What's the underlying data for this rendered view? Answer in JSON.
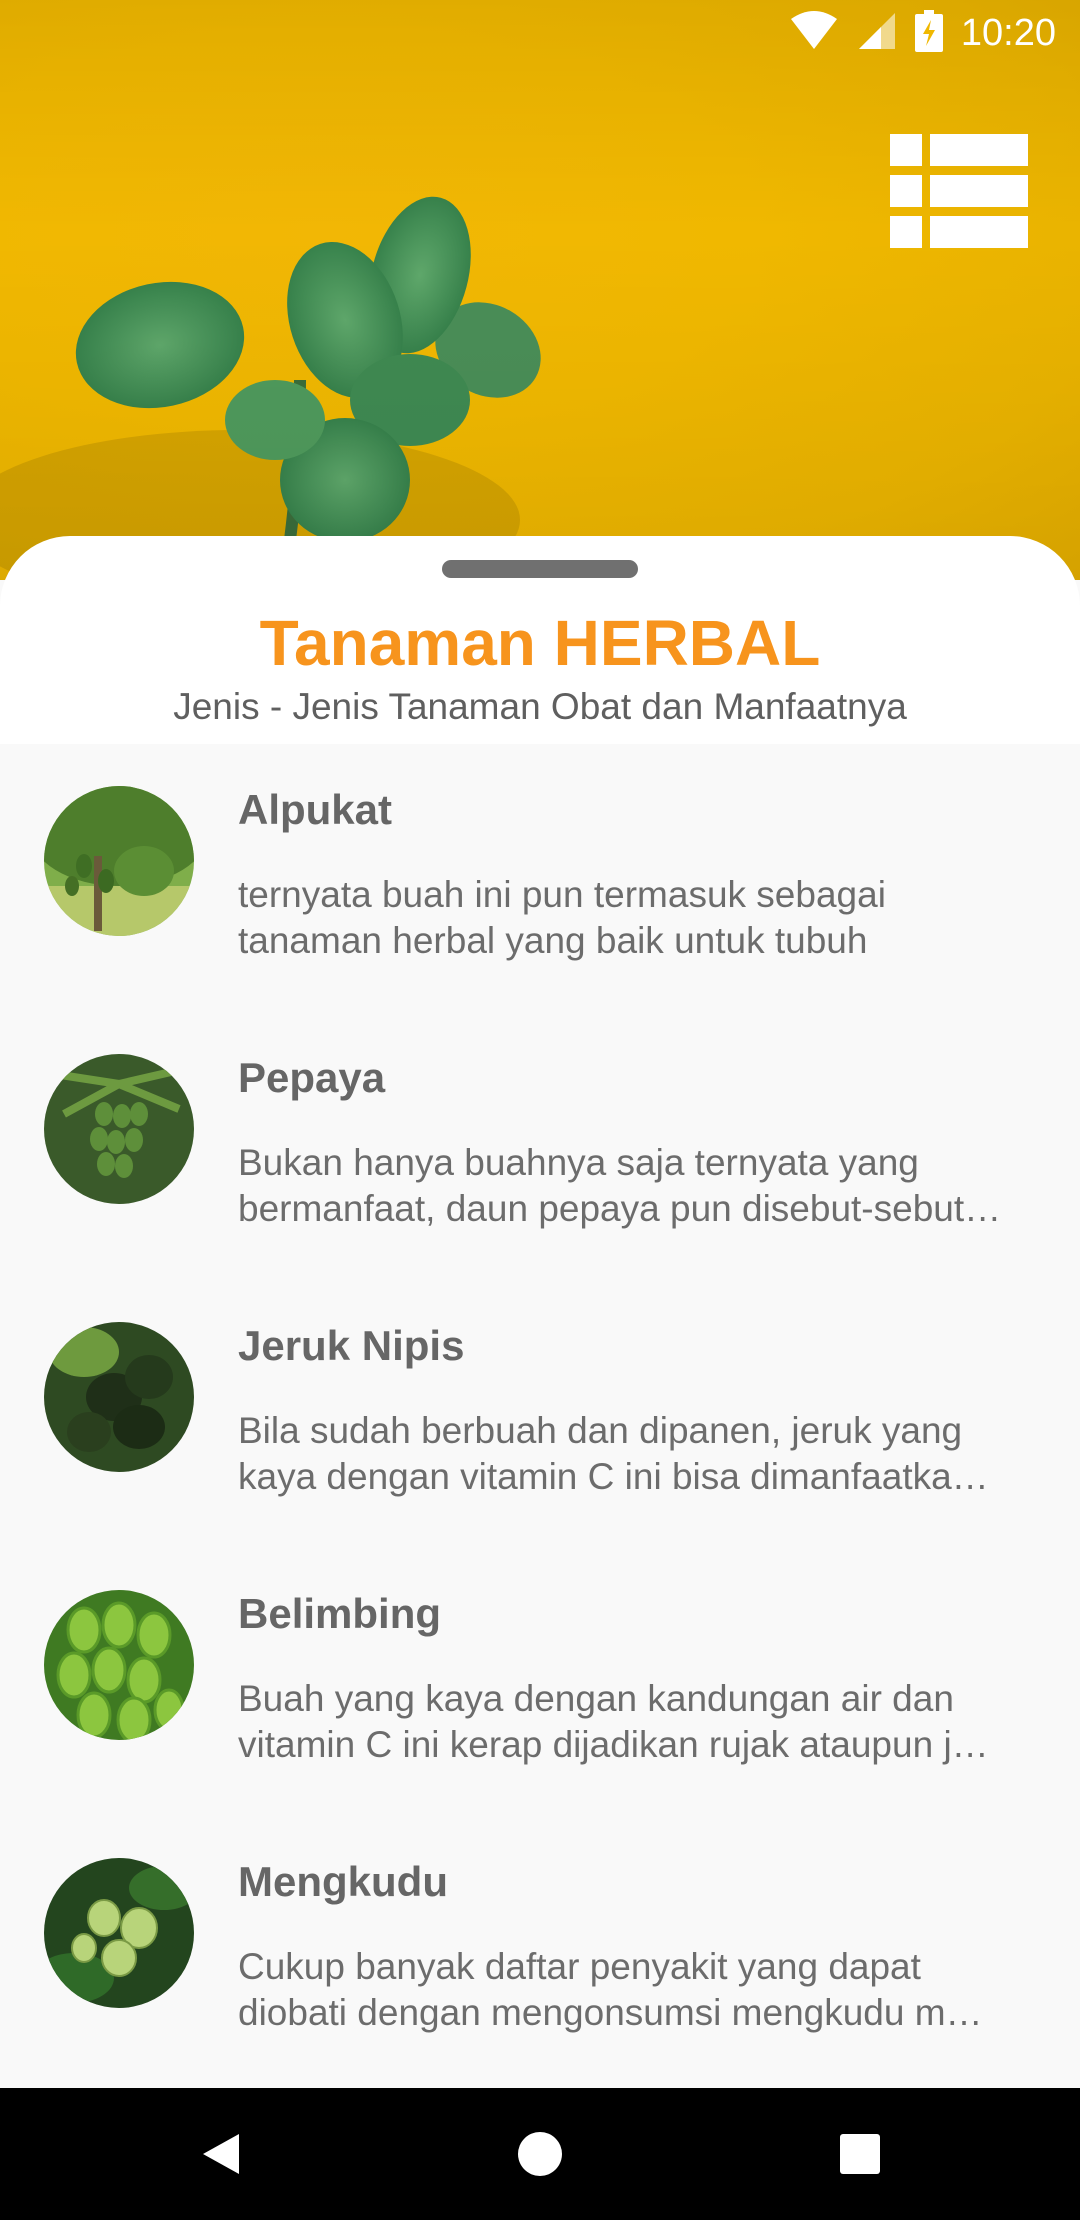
{
  "status": {
    "time": "10:20"
  },
  "header": {
    "title": "Tanaman HERBAL",
    "subtitle": "Jenis - Jenis Tanaman Obat dan Manfaatnya",
    "title_color": "#f7941d",
    "background_color": "#f0b800"
  },
  "toolbar": {
    "grid_icon": "grid-list-icon"
  },
  "plants": [
    {
      "name": "Alpukat",
      "description": "ternyata buah ini pun termasuk sebagai tanaman herbal yang baik untuk tubuh",
      "icon": "avocado-tree-photo"
    },
    {
      "name": "Pepaya",
      "description": "Bukan hanya buahnya saja ternyata yang bermanfaat, daun pepaya pun disebut-sebut…",
      "icon": "papaya-tree-photo"
    },
    {
      "name": "Jeruk Nipis",
      "description": "Bila sudah berbuah dan dipanen, jeruk yang kaya dengan vitamin C ini bisa dimanfaatka…",
      "icon": "lime-photo"
    },
    {
      "name": "Belimbing",
      "description": "Buah yang kaya dengan kandungan air dan vitamin C ini kerap dijadikan rujak ataupun j…",
      "icon": "starfruit-photo"
    },
    {
      "name": "Mengkudu",
      "description": "Cukup banyak daftar penyakit yang dapat diobati dengan mengonsumsi mengkudu m…",
      "icon": "noni-photo"
    }
  ],
  "navigation": {
    "back_icon": "back-icon",
    "home_icon": "home-icon",
    "recents_icon": "recents-icon"
  }
}
